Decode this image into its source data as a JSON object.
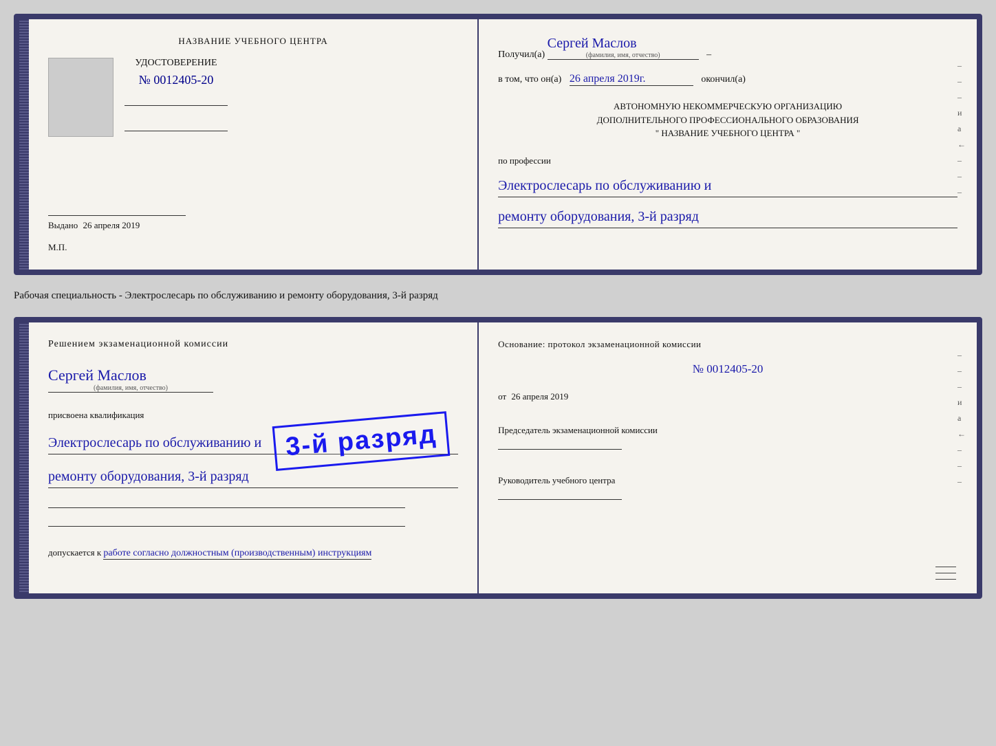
{
  "card1": {
    "left": {
      "center_title": "НАЗВАНИЕ УЧЕБНОГО ЦЕНТРА",
      "cert_label": "УДОСТОВЕРЕНИЕ",
      "cert_number": "№ 0012405-20",
      "issued_label": "Выдано",
      "issued_date": "26 апреля 2019",
      "mp_label": "М.П."
    },
    "right": {
      "received_label": "Получил(а)",
      "received_name": "Сергей Маслов",
      "name_sublabel": "(фамилия, имя, отчество)",
      "in_that_label": "в том, что он(а)",
      "completed_date": "26 апреля 2019г.",
      "completed_label": "окончил(а)",
      "org_line1": "АВТОНОМНУЮ НЕКОММЕРЧЕСКУЮ ОРГАНИЗАЦИЮ",
      "org_line2": "ДОПОЛНИТЕЛЬНОГО ПРОФЕССИОНАЛЬНОГО ОБРАЗОВАНИЯ",
      "org_line3": "\"   НАЗВАНИЕ УЧЕБНОГО ЦЕНТРА   \"",
      "profession_label": "по профессии",
      "profession_line1": "Электрослесарь по обслуживанию и",
      "profession_line2": "ремонту оборудования, 3-й разряд"
    }
  },
  "between_text": "Рабочая специальность - Электрослесарь по обслуживанию и ремонту оборудования, 3-й разряд",
  "card2": {
    "left": {
      "decision_text": "Решением экзаменационной комиссии",
      "person_name": "Сергей Маслов",
      "name_sublabel": "(фамилия, имя, отчество)",
      "assigned_label": "присвоена квалификация",
      "qual_line1": "Электрослесарь по обслуживанию и",
      "qual_line2": "ремонту оборудования, 3-й разряд",
      "admitted_label": "допускается к",
      "admitted_detail": "работе согласно должностным (производственным) инструкциям"
    },
    "right": {
      "basis_label": "Основание: протокол экзаменационной комиссии",
      "protocol_number": "№  0012405-20",
      "date_prefix": "от",
      "protocol_date": "26 апреля 2019",
      "chairman_label": "Председатель экзаменационной комиссии",
      "leader_label": "Руководитель учебного центра"
    },
    "stamp": {
      "line1": "3-й разряд"
    }
  },
  "side_letters": {
    "letters1": [
      "и",
      "а",
      "←",
      "–",
      "–",
      "–"
    ],
    "letters2": [
      "и",
      "а",
      "←",
      "–",
      "–",
      "–"
    ]
  }
}
